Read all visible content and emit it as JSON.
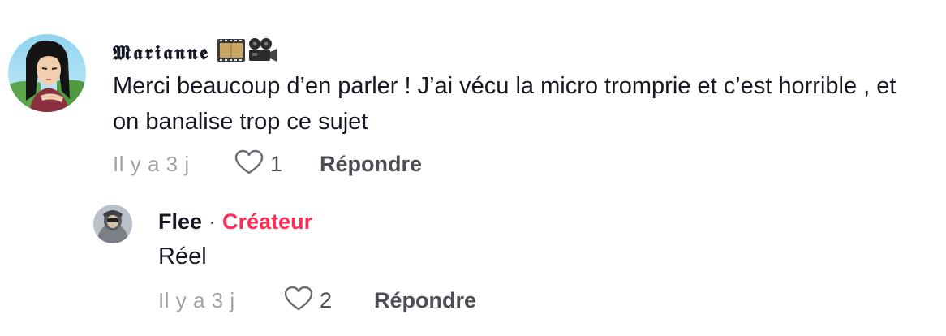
{
  "comments": [
    {
      "author": "𝕸𝖆𝖗𝖎𝖆𝖓𝖓𝖊",
      "author_emoji": [
        "film-strip",
        "movie-camera"
      ],
      "text": "Merci beaucoup d’en parler ! J’ai vécu la micro tromprie et c’est horrible , et on banalise trop ce sujet",
      "time": "Il y a 3 j",
      "likes": "1",
      "reply_label": "Répondre"
    }
  ],
  "reply": {
    "author": "Flee",
    "separator": "·",
    "badge": "Créateur",
    "text": "Réel",
    "time": "Il y a 3 j",
    "likes": "2",
    "reply_label": "Répondre"
  },
  "colors": {
    "text": "#161823",
    "muted": "#a1a2a7",
    "secondary": "#4c4d55",
    "creator_badge": "#fe2c55"
  },
  "icons": [
    "heart-outline-icon",
    "film-strip-icon",
    "movie-camera-icon"
  ]
}
